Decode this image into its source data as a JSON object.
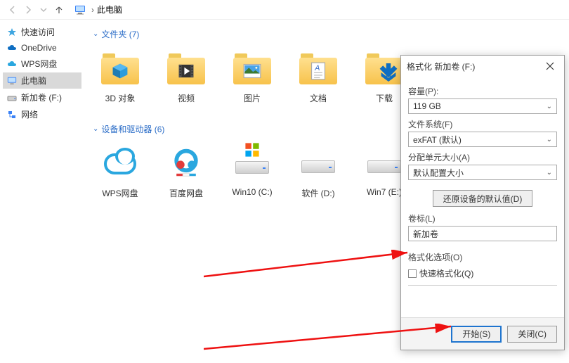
{
  "address": {
    "location": "此电脑"
  },
  "sidebar": {
    "items": [
      {
        "label": "快速访问"
      },
      {
        "label": "OneDrive"
      },
      {
        "label": "WPS网盘"
      },
      {
        "label": "此电脑"
      },
      {
        "label": "新加卷 (F:)"
      },
      {
        "label": "网络"
      }
    ]
  },
  "sections": {
    "folders_header": "文件夹 (7)",
    "devices_header": "设备和驱动器 (6)"
  },
  "folders": [
    {
      "label": "3D 对象"
    },
    {
      "label": "视频"
    },
    {
      "label": "图片"
    },
    {
      "label": "文档"
    },
    {
      "label": "下载"
    }
  ],
  "drives": [
    {
      "label": "WPS网盘"
    },
    {
      "label": "百度网盘"
    },
    {
      "label": "Win10 (C:)"
    },
    {
      "label": "软件 (D:)"
    },
    {
      "label": "Win7 (E:)"
    }
  ],
  "dialog": {
    "title": "格式化 新加卷 (F:)",
    "capacity_label": "容量(P):",
    "capacity_value": "119 GB",
    "filesystem_label": "文件系统(F)",
    "filesystem_value": "exFAT (默认)",
    "alloc_label": "分配单元大小(A)",
    "alloc_value": "默认配置大小",
    "restore": "还原设备的默认值(D)",
    "volume_label": "卷标(L)",
    "volume_value": "新加卷",
    "options_label": "格式化选项(O)",
    "quick_format": "快速格式化(Q)",
    "start": "开始(S)",
    "close": "关闭(C)"
  }
}
